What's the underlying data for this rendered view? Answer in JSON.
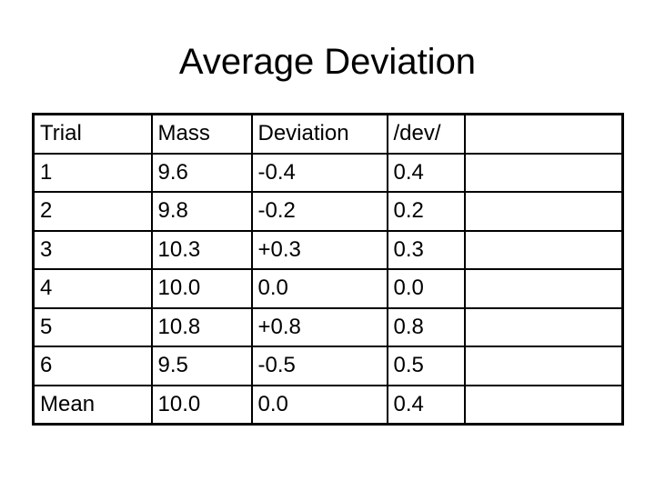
{
  "title": "Average Deviation",
  "table": {
    "headers": [
      "Trial",
      "Mass",
      "Deviation",
      "/dev/",
      ""
    ],
    "rows": [
      [
        "1",
        "9.6",
        "-0.4",
        "0.4",
        ""
      ],
      [
        "2",
        "9.8",
        "-0.2",
        "0.2",
        ""
      ],
      [
        "3",
        "10.3",
        "+0.3",
        "0.3",
        ""
      ],
      [
        "4",
        "10.0",
        "0.0",
        "0.0",
        ""
      ],
      [
        "5",
        "10.8",
        "+0.8",
        "0.8",
        ""
      ],
      [
        "6",
        "9.5",
        "-0.5",
        "0.5",
        ""
      ],
      [
        "Mean",
        "10.0",
        "0.0",
        "0.4",
        ""
      ]
    ]
  }
}
